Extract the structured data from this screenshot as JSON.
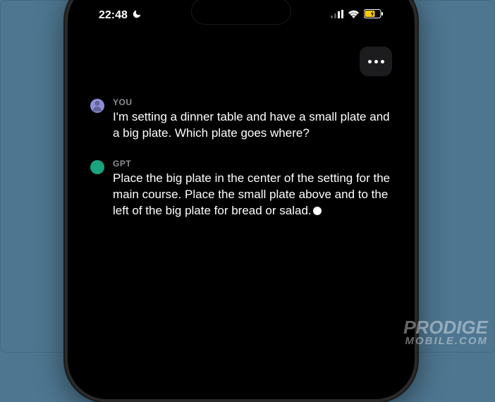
{
  "status_bar": {
    "time": "22:48",
    "dnd_active": true
  },
  "more_button": {
    "label": "More options"
  },
  "chat": [
    {
      "sender_label": "YOU",
      "avatar_color": "#8e8ed8",
      "text": "I'm setting a dinner table and have a small plate and a big plate. Which plate goes where?"
    },
    {
      "sender_label": "GPT",
      "avatar_color": "#19a37f",
      "text": "Place the big plate in the center of the setting for the main course. Place the small plate above and to the left of the big plate for bread or salad.",
      "typing_cursor": true
    }
  ],
  "watermark": {
    "line1": "PRODIGE",
    "line2": "MOBILE.COM"
  }
}
